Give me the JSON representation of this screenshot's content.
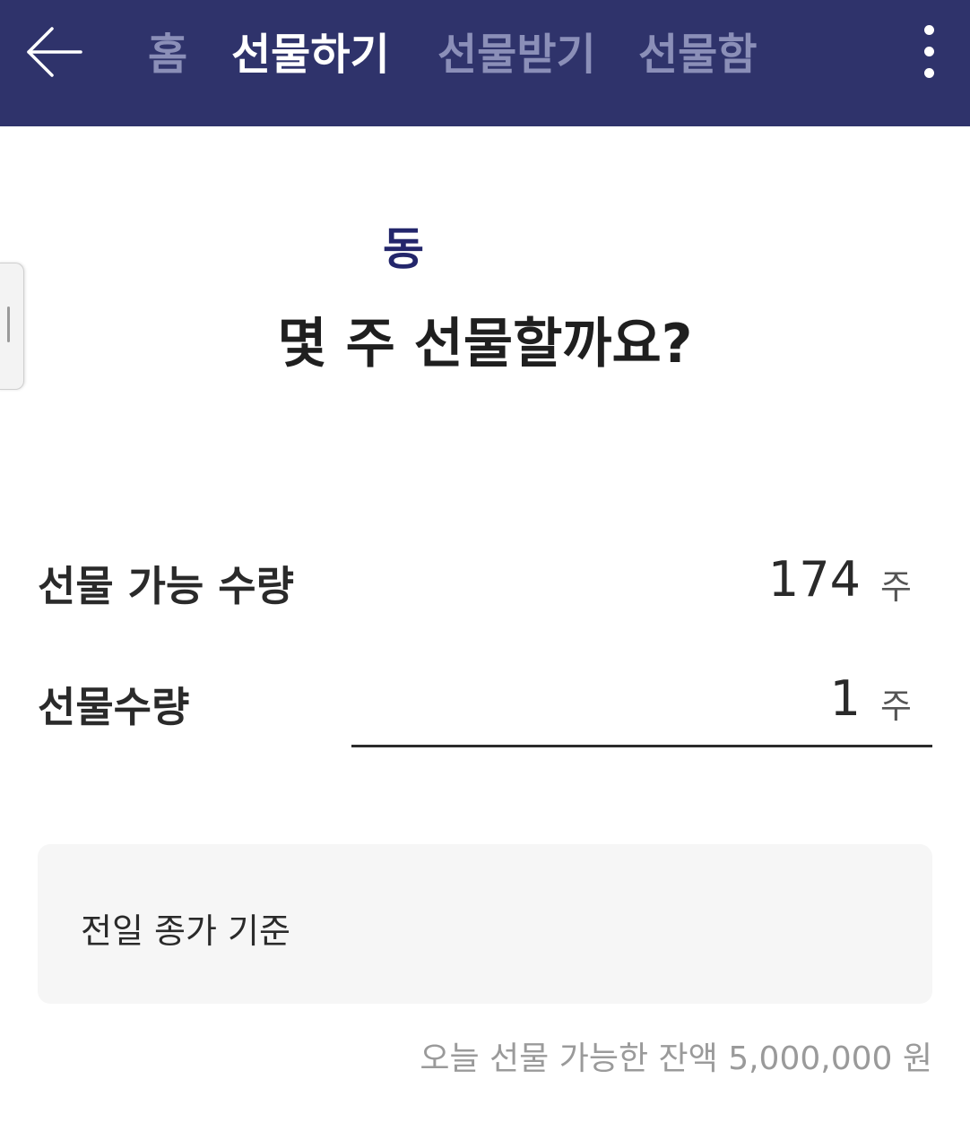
{
  "header": {
    "back_icon": "arrow-left-icon",
    "tabs": [
      {
        "label": "홈",
        "active": false
      },
      {
        "label": "선물하기",
        "active": true
      },
      {
        "label": "선물받기",
        "active": false
      },
      {
        "label": "선물함",
        "active": false
      }
    ],
    "more_icon": "more-vertical-icon"
  },
  "title": {
    "stock_name": "동",
    "question": "몇 주 선물할까요?"
  },
  "available": {
    "label": "선물 가능 수량",
    "value": "174",
    "unit": "주"
  },
  "quantity": {
    "label": "선물수량",
    "value": "1",
    "unit": "주"
  },
  "info": {
    "text": "전일 종가 기준"
  },
  "balance": {
    "text": "오늘 선물 가능한 잔액 5,000,000 원"
  },
  "colors": {
    "header_bg": "#2f336b",
    "accent": "#23266b",
    "tab_inactive": "#8b8fb8"
  }
}
